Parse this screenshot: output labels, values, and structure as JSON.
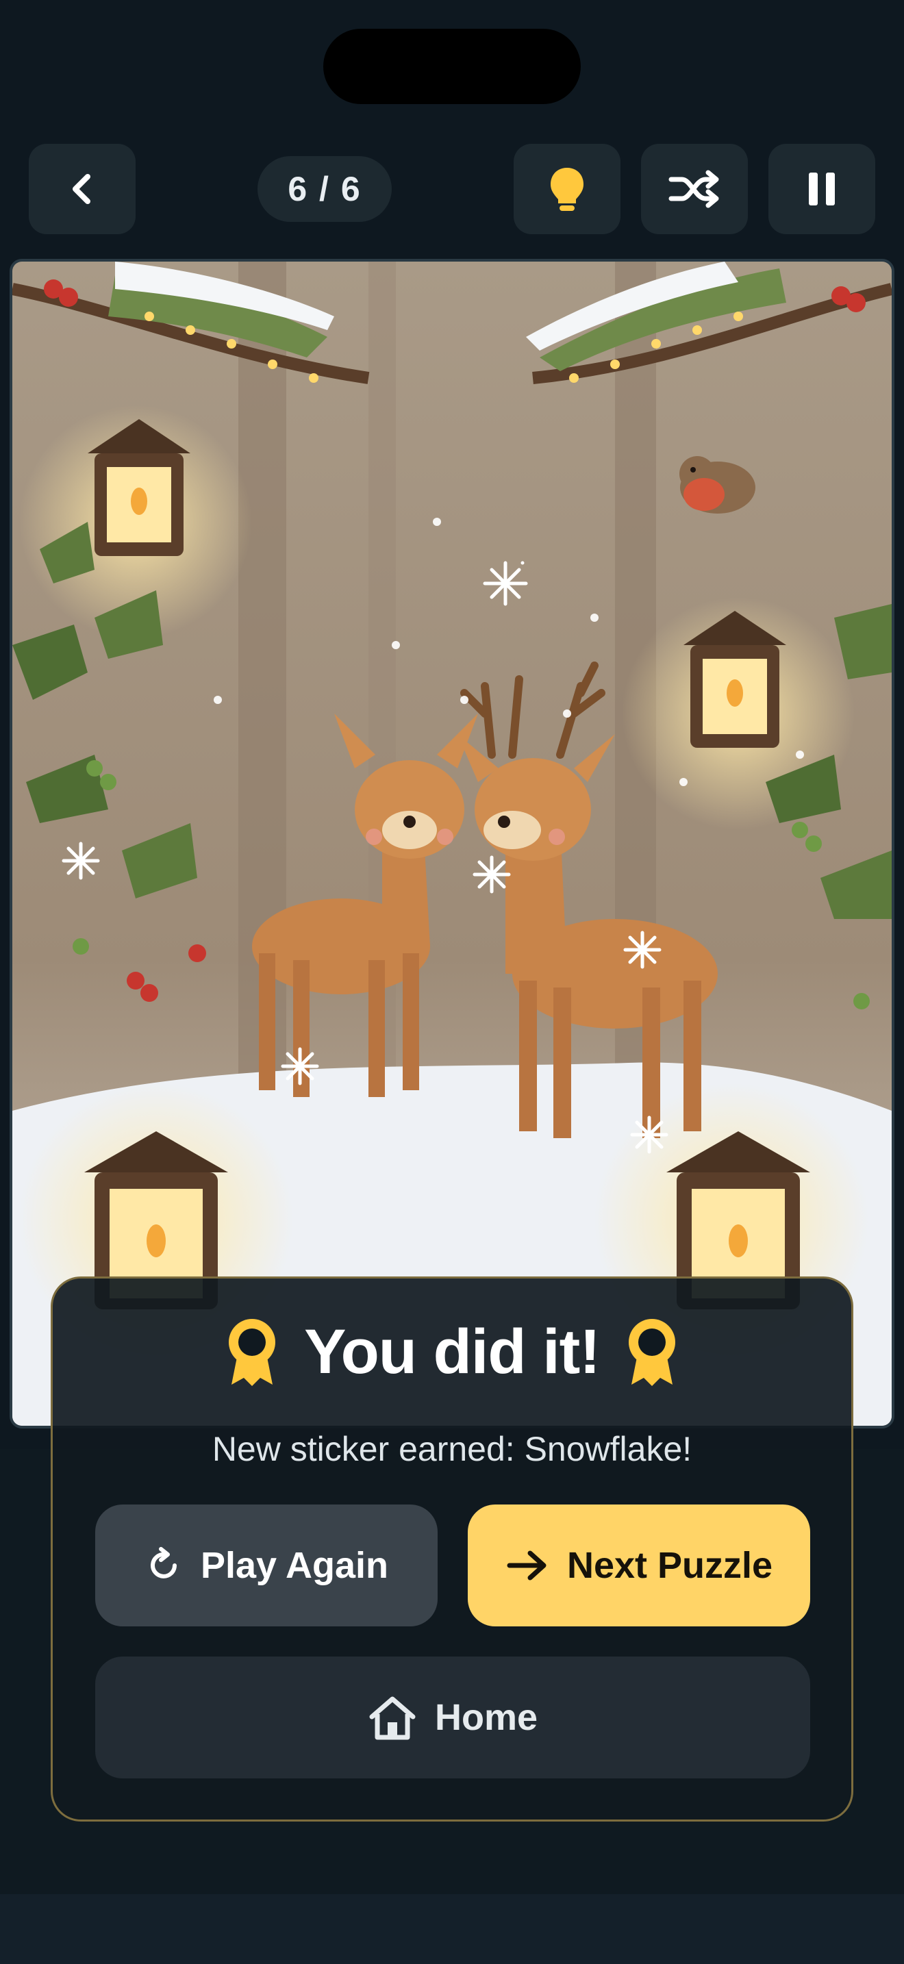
{
  "header": {
    "progress_label": "6 / 6",
    "back_icon": "chevron-left-icon",
    "hint_icon": "lightbulb-icon",
    "shuffle_icon": "shuffle-icon",
    "pause_icon": "pause-icon"
  },
  "puzzle": {
    "scene": "puzzle-image"
  },
  "modal": {
    "title": "You did it!",
    "subtitle": "New sticker earned: Snowflake!",
    "play_again_label": "Play Again",
    "next_puzzle_label": "Next Puzzle",
    "home_label": "Home",
    "badge_icon": "award-ribbon-icon"
  },
  "colors": {
    "background": "#0e1820",
    "button_dark": "#1d2930",
    "accent_yellow": "#ffd467",
    "modal_border": "#7d6d3e"
  }
}
